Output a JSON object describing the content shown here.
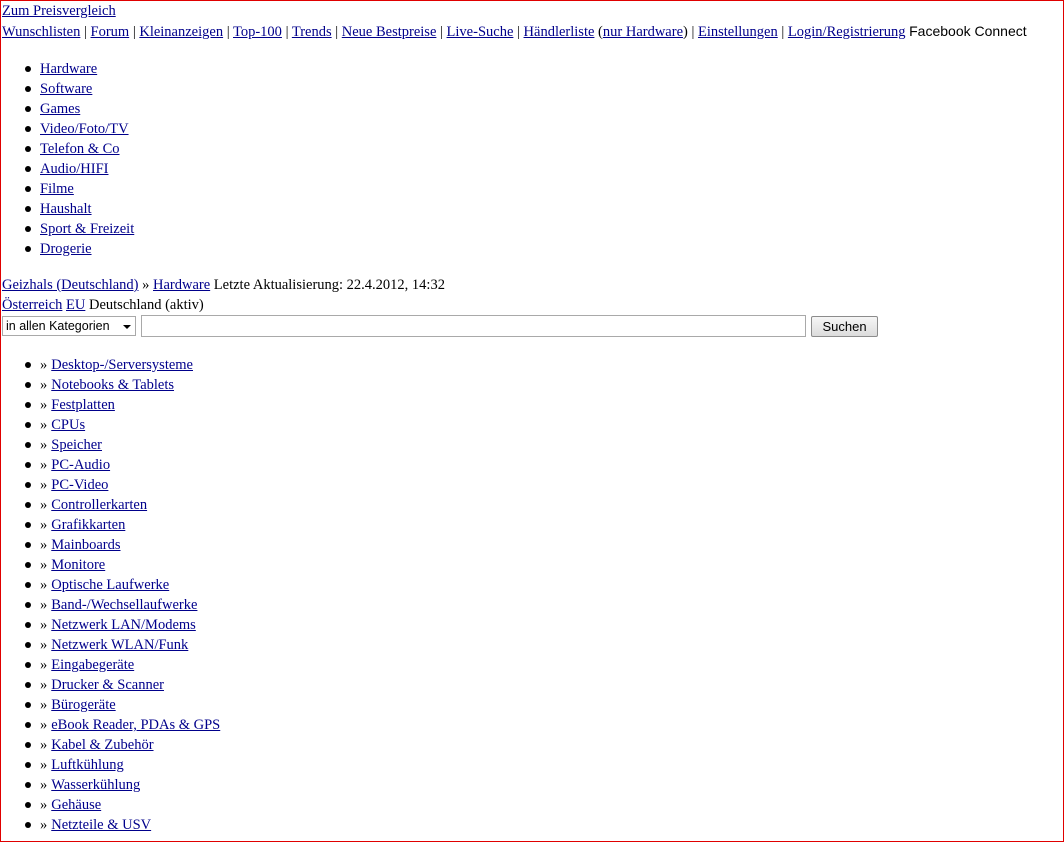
{
  "top_link": "Zum Preisvergleich",
  "topbar": {
    "links": [
      "Wunschlisten",
      "Forum",
      "Kleinanzeigen",
      "Top-100",
      "Trends",
      "Neue Bestpreise",
      "Live-Suche",
      "Händlerliste",
      "nur Hardware",
      "Einstellungen",
      "Login/Registrierung"
    ],
    "facebook": "Facebook Connect"
  },
  "nav": [
    "Hardware",
    "Software",
    "Games",
    "Video/Foto/TV",
    "Telefon & Co",
    "Audio/HIFI",
    "Filme",
    "Haushalt",
    "Sport & Freizeit",
    "Drogerie"
  ],
  "breadcrumb": {
    "home": "Geizhals (Deutschland)",
    "sep": "»",
    "section": "Hardware",
    "update": "Letzte Aktualisierung: 22.4.2012, 14:32"
  },
  "regions": {
    "at": "Österreich",
    "eu": "EU",
    "de": "Deutschland (aktiv)"
  },
  "search": {
    "category": "in allen Kategorien",
    "value": "",
    "button": "Suchen"
  },
  "categories": [
    "Desktop-/Serversysteme",
    "Notebooks & Tablets",
    "Festplatten",
    "CPUs",
    "Speicher",
    "PC-Audio",
    "PC-Video",
    "Controllerkarten",
    "Grafikkarten",
    "Mainboards",
    "Monitore",
    "Optische Laufwerke",
    "Band-/Wechsellaufwerke",
    "Netzwerk LAN/Modems",
    "Netzwerk WLAN/Funk",
    "Eingabegeräte",
    "Drucker & Scanner",
    "Bürogeräte",
    "eBook Reader, PDAs & GPS",
    "Kabel & Zubehör",
    "Luftkühlung",
    "Wasserkühlung",
    "Gehäuse",
    "Netzteile & USV"
  ]
}
